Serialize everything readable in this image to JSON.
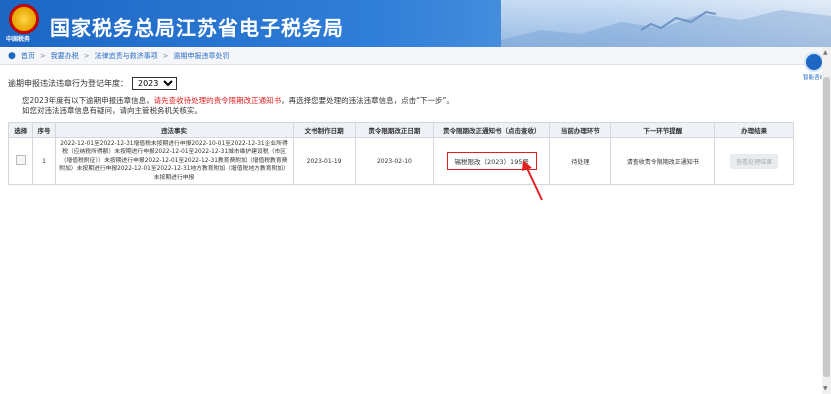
{
  "header": {
    "emblem_text": "中国税务",
    "title": "国家税务总局江苏省电子税务局"
  },
  "breadcrumb": [
    "首页",
    "我要办税",
    "法律追责与救济事项",
    "逾期申报违章处罚"
  ],
  "breadcrumb_sep": ">",
  "year_selector": {
    "label": "逾期申报违法违章行为登记年度：",
    "value": "2023"
  },
  "notice": {
    "line1_pre": "您2023年度有以下逾期申报违章信息，",
    "line1_red": "请先查收待处理的责令限期改正通知书",
    "line1_post": "，再选择您要处理的违法违章信息，点击“下一步”。",
    "line2": "如您对违法违章信息有疑问，请向主管税务机关核实。"
  },
  "table": {
    "headers": [
      "选择",
      "序号",
      "违法事实",
      "文书制作日期",
      "责令限期改正日期",
      "责令限期改正通知书（点击查收）",
      "当前办理环节",
      "下一环节提醒",
      "办理结果"
    ],
    "rows": [
      {
        "index": "1",
        "fact": "2022-12-01至2022-12-31增值税未按期进行申报2022-10-01至2022-12-31企业所得税（应纳税所得额）未按期进行申报2022-12-01至2022-12-31城市维护建设税（市区（增值税附征））未按期进行申报2022-12-01至2022-12-31教育费附加（增值税教育费附加）未按期进行申报2022-12-01至2022-12-31地方教育附加（增值税地方教育附加）未按期进行申报",
        "doc_date": "2023-01-19",
        "deadline": "2023-02-10",
        "notice_no": "锡税限改（2023）195号",
        "stage": "待处理",
        "next_hint": "请查收责令限期改正通知书",
        "result_btn": "查看处理结果"
      }
    ]
  },
  "assistant": {
    "label": "智能咨询",
    "icon": "headset-icon"
  },
  "colors": {
    "header_blue": "#1d67c4",
    "alert_red": "#e02020"
  }
}
